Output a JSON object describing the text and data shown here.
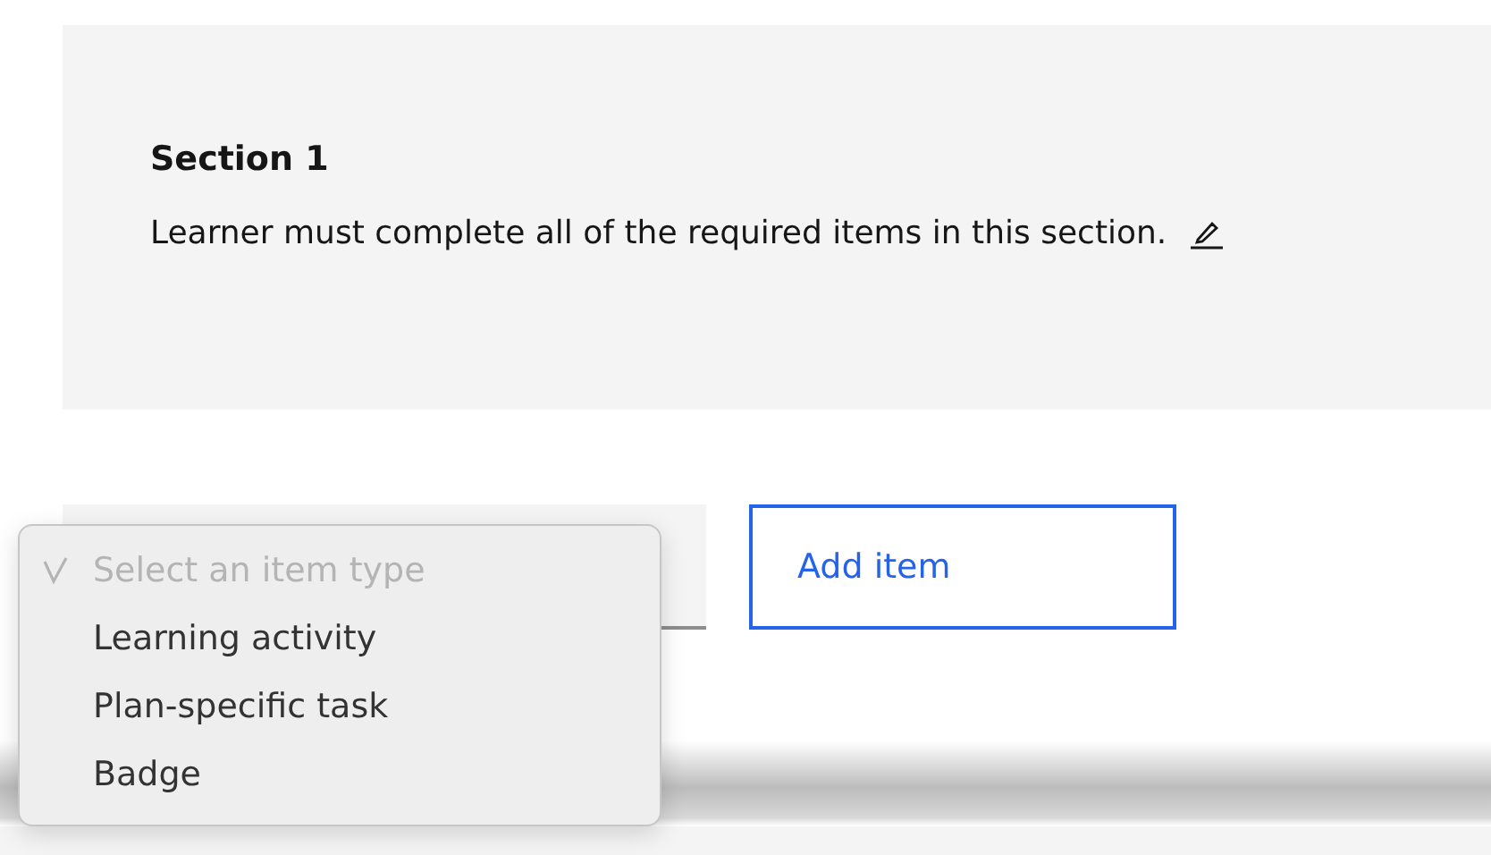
{
  "section": {
    "title": "Section 1",
    "description": "Learner must complete all of the required items in this section."
  },
  "item_type_select": {
    "options": [
      {
        "label": "Select an item type",
        "selected": true,
        "disabled": true
      },
      {
        "label": "Learning activity",
        "selected": false,
        "disabled": false
      },
      {
        "label": "Plan-specific task",
        "selected": false,
        "disabled": false
      },
      {
        "label": "Badge",
        "selected": false,
        "disabled": false
      }
    ]
  },
  "add_button": {
    "label": "Add item"
  }
}
